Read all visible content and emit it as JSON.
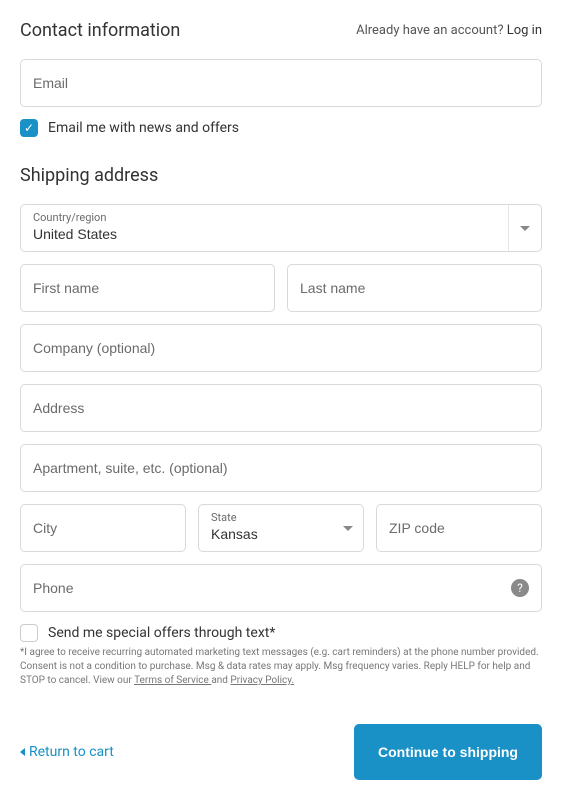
{
  "contact": {
    "heading": "Contact information",
    "login_prompt": "Already have an account?",
    "login_link": "Log in",
    "email_placeholder": "Email",
    "news_checkbox_checked": true,
    "news_label": "Email me with news and offers"
  },
  "shipping": {
    "heading": "Shipping address",
    "country_label": "Country/region",
    "country_value": "United States",
    "first_name_placeholder": "First name",
    "last_name_placeholder": "Last name",
    "company_placeholder": "Company (optional)",
    "address_placeholder": "Address",
    "apartment_placeholder": "Apartment, suite, etc. (optional)",
    "city_placeholder": "City",
    "state_label": "State",
    "state_value": "Kansas",
    "zip_placeholder": "ZIP code",
    "phone_placeholder": "Phone",
    "sms_checkbox_checked": false,
    "sms_label": "Send me special offers through text*",
    "fine_print_prefix": "*I agree to receive recurring automated marketing text messages (e.g. cart reminders) at the phone number provided. Consent is not a condition to purchase. Msg & data rates may apply. Msg frequency varies. Reply HELP for help and STOP to cancel. View our ",
    "tos_text": "Terms of Service ",
    "and_text": "and ",
    "privacy_text": "Privacy Policy."
  },
  "footer": {
    "return_label": "Return to cart",
    "continue_label": "Continue to shipping"
  }
}
